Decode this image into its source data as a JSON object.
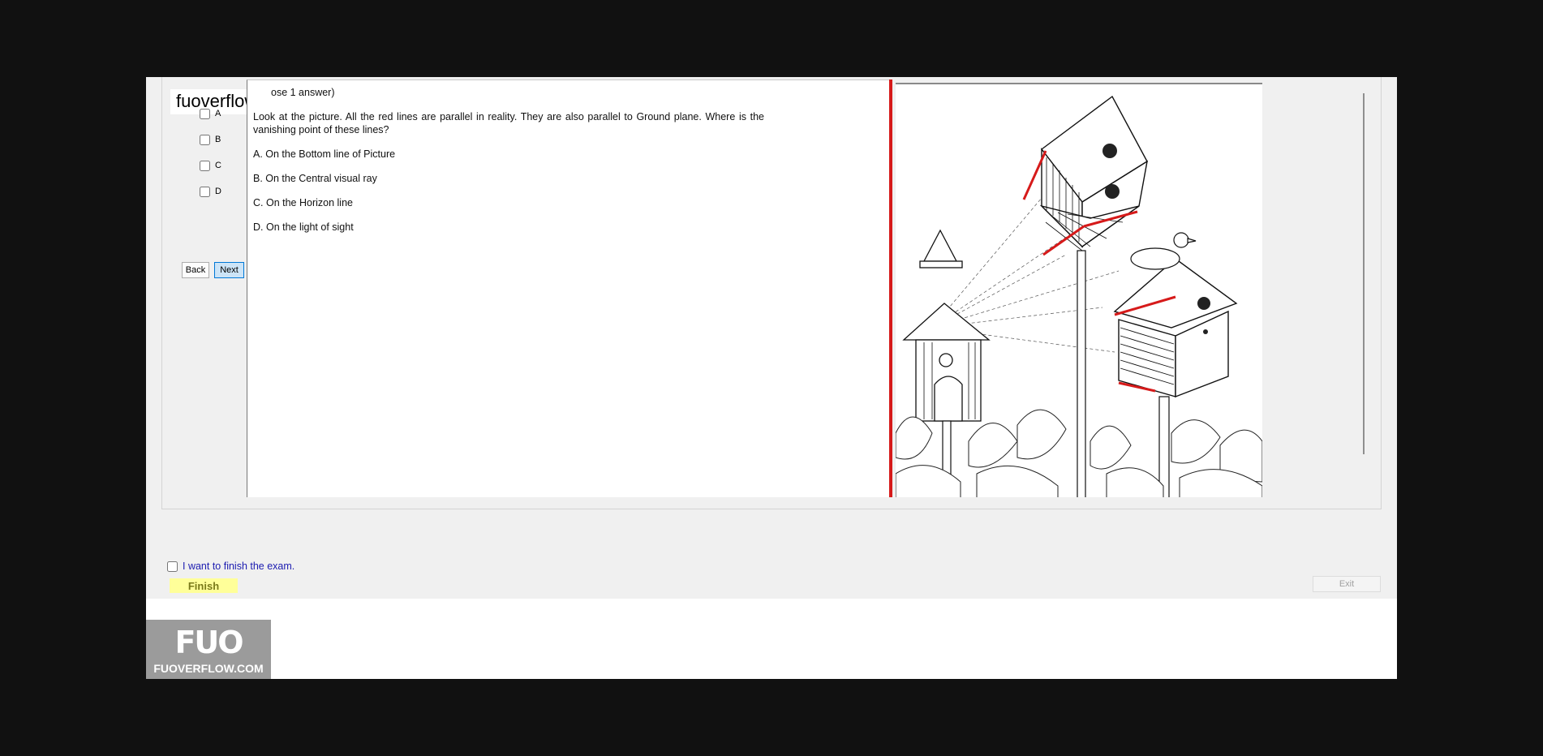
{
  "watermark": {
    "text": "fuoverflow"
  },
  "answers": [
    "A",
    "B",
    "C",
    "D"
  ],
  "nav": {
    "back_label": "Back",
    "next_label": "Next"
  },
  "question": {
    "header": "ose 1 answer)",
    "body": "Look at the picture. All the red lines are parallel in reality. They are also parallel to Ground plane. Where is the vanishing point of these lines?",
    "options": [
      "A.  On the Bottom line of Picture",
      "B.  On the Central visual ray",
      "C.  On the Horizon line",
      "D.  On the light of sight"
    ]
  },
  "finish": {
    "checkbox_label": "I want to finish the exam.",
    "button_label": "Finish"
  },
  "exit": {
    "label": "Exit"
  },
  "logo": {
    "mark": "FUO",
    "site": "FUOVERFLOW.COM"
  },
  "colors": {
    "accent_red": "#d61a1a",
    "finish_bg": "#ffff99",
    "link_blue": "#1b1bb0"
  },
  "image": {
    "description_icon": "birdhouse-perspective-drawing"
  }
}
